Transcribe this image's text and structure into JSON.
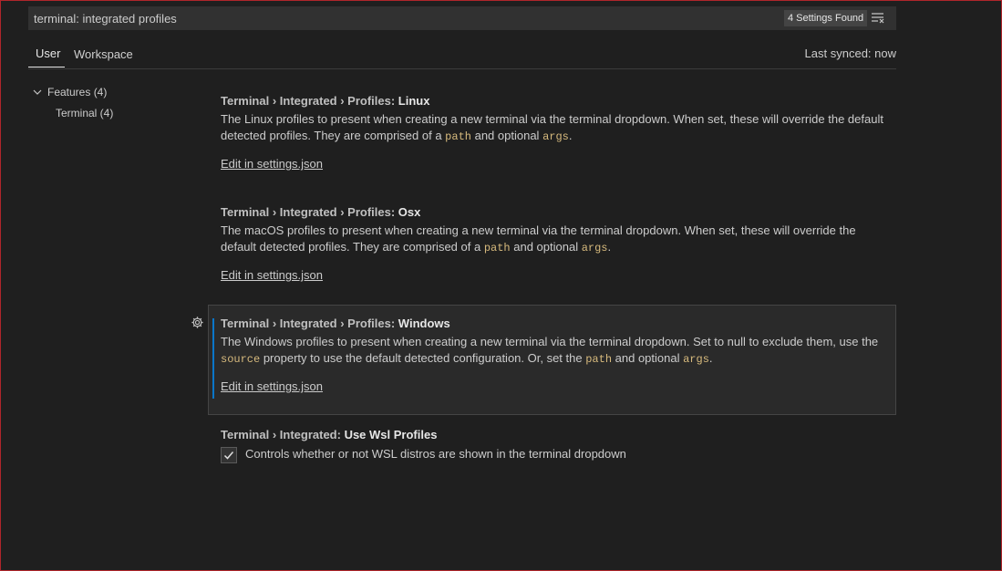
{
  "search": {
    "value": "terminal: integrated profiles",
    "results_badge": "4 Settings Found",
    "clear_icon": "clear-filter-icon"
  },
  "tabs": [
    {
      "label": "User",
      "active": true
    },
    {
      "label": "Workspace",
      "active": false
    }
  ],
  "sync_status": "Last synced: now",
  "toc": {
    "features": "Features (4)",
    "terminal": "Terminal (4)",
    "chevron_icon": "chevron-down-icon"
  },
  "settings": [
    {
      "category": "Terminal › Integrated › Profiles: ",
      "key": "Linux",
      "desc_1": "The Linux profiles to present when creating a new terminal via the terminal dropdown. When set, these will override the default detected profiles. They are comprised of a ",
      "code_1": "path",
      "desc_2": " and optional ",
      "code_2": "args",
      "desc_3": ".",
      "link": "Edit in settings.json"
    },
    {
      "category": "Terminal › Integrated › Profiles: ",
      "key": "Osx",
      "desc_1": "The macOS profiles to present when creating a new terminal via the terminal dropdown. When set, these will override the default detected profiles. They are comprised of a ",
      "code_1": "path",
      "desc_2": " and optional ",
      "code_2": "args",
      "desc_3": ".",
      "link": "Edit in settings.json"
    },
    {
      "category": "Terminal › Integrated › Profiles: ",
      "key": "Windows",
      "desc_1": "The Windows profiles to present when creating a new terminal via the terminal dropdown. Set to null to exclude them, use the ",
      "code_1": "source",
      "desc_2": " property to use the default detected configuration. Or, set the ",
      "code_2": "path",
      "desc_3": " and optional ",
      "code_3": "args",
      "desc_4": ".",
      "link": "Edit in settings.json"
    },
    {
      "category": "Terminal › Integrated: ",
      "key": "Use Wsl Profiles",
      "checkbox_label": "Controls whether or not WSL distros are shown in the terminal dropdown",
      "checked": true
    }
  ],
  "colors": {
    "background": "#1f1f1f",
    "focus_accent": "#0a76c9",
    "code_text": "#d7ba7d",
    "window_border": "#b0262b"
  }
}
